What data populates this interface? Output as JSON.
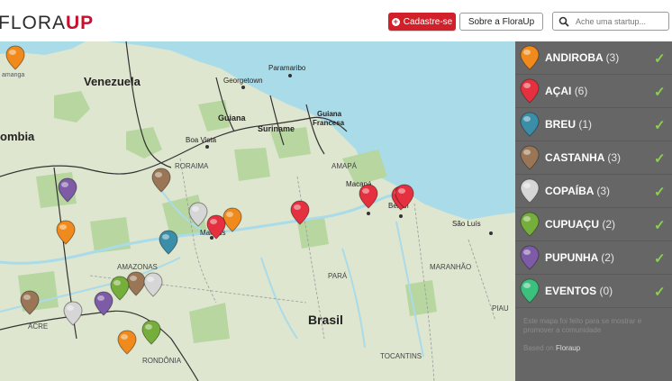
{
  "header": {
    "logo_left": "FLORA",
    "logo_right": "UP",
    "signup_label": "Cadastre-se",
    "about_label": "Sobre a FloraUp",
    "search_placeholder": "Ache uma startup..."
  },
  "categories": [
    {
      "label": "ANDIROBA",
      "count": "(3)",
      "color": "#f08a1c"
    },
    {
      "label": "AÇAI",
      "count": "(6)",
      "color": "#e5313f"
    },
    {
      "label": "BREU",
      "count": "(1)",
      "color": "#3b8ea8"
    },
    {
      "label": "CASTANHA",
      "count": "(3)",
      "color": "#9a7656"
    },
    {
      "label": "COPAÍBA",
      "count": "(3)",
      "color": "#d6d6d6"
    },
    {
      "label": "CUPUAÇU",
      "count": "(2)",
      "color": "#76ae3c"
    },
    {
      "label": "PUPUNHA",
      "count": "(2)",
      "color": "#7d5ba6"
    },
    {
      "label": "EVENTOS",
      "count": "(0)",
      "color": "#3cc07e"
    }
  ],
  "panel": {
    "note": "Este mapa foi feito para se mostrar e promover a comunidade",
    "credit_prefix": "Based on",
    "credit_name": "Floraup"
  },
  "map_labels": {
    "venezuela": "Venezuela",
    "colombia": "ombia",
    "georgetown": "Georgetown",
    "paramaribo": "Paramaribo",
    "guiana": "Guiana",
    "suriname": "Suriname",
    "guiana_francesa_1": "Guiana",
    "guiana_francesa_2": "Francesa",
    "roraima": "RORAIMA",
    "boa_vista": "Boa Vista",
    "amapa": "AMAPÁ",
    "macapa": "Macapá",
    "belem": "Belém",
    "sao_luis": "São Luís",
    "manaus": "Manaus",
    "amazonas": "AMAZONAS",
    "para": "PARÁ",
    "maranhao": "MARANHÃO",
    "piaui": "PIAU",
    "brasil": "Brasil",
    "acre": "ACRE",
    "rondonia": "RONDÔNIA",
    "tocantins": "TOCANTINS",
    "manaus_top": "amanga"
  },
  "colors": {
    "ocean": "#a9dbe8",
    "land": "#dfe6d0",
    "forest": "#b7d6a0",
    "panel_bg": "#666666",
    "check": "#8bd14b",
    "brand_red": "#c8102e"
  }
}
